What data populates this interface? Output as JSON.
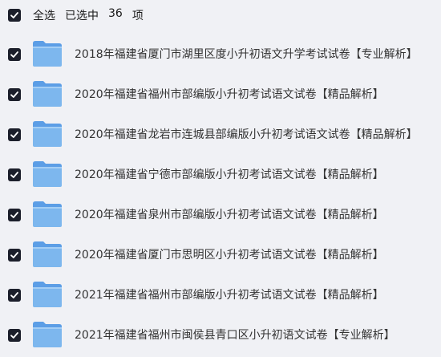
{
  "header": {
    "select_all_label": "全选",
    "selected_prefix": "已选中",
    "selected_count": "36",
    "selected_suffix": "项"
  },
  "colors": {
    "checkbox_bg": "#1c1f2b",
    "folder_blue": "#7db7ee",
    "background": "#f0f1f5"
  },
  "files": [
    {
      "title": "2018年福建省厦门市湖里区度小升初语文升学考试试卷【专业解析】",
      "icon": "folder-icon"
    },
    {
      "title": "2020年福建省福州市部编版小升初考试语文试卷【精品解析】",
      "icon": "folder-icon"
    },
    {
      "title": "2020年福建省龙岩市连城县部编版小升初考试语文试卷【精品解析】",
      "icon": "folder-icon"
    },
    {
      "title": "2020年福建省宁德市部编版小升初考试语文试卷【精品解析】",
      "icon": "folder-icon"
    },
    {
      "title": "2020年福建省泉州市部编版小升初考试语文试卷【精品解析】",
      "icon": "folder-icon"
    },
    {
      "title": "2020年福建省厦门市思明区小升初考试语文试卷【精品解析】",
      "icon": "folder-icon"
    },
    {
      "title": "2021年福建省福州市部编版小升初考试语文试卷【精品解析】",
      "icon": "folder-icon"
    },
    {
      "title": "2021年福建省福州市闽侯县青口区小升初语文试卷【专业解析】",
      "icon": "folder-icon"
    }
  ]
}
